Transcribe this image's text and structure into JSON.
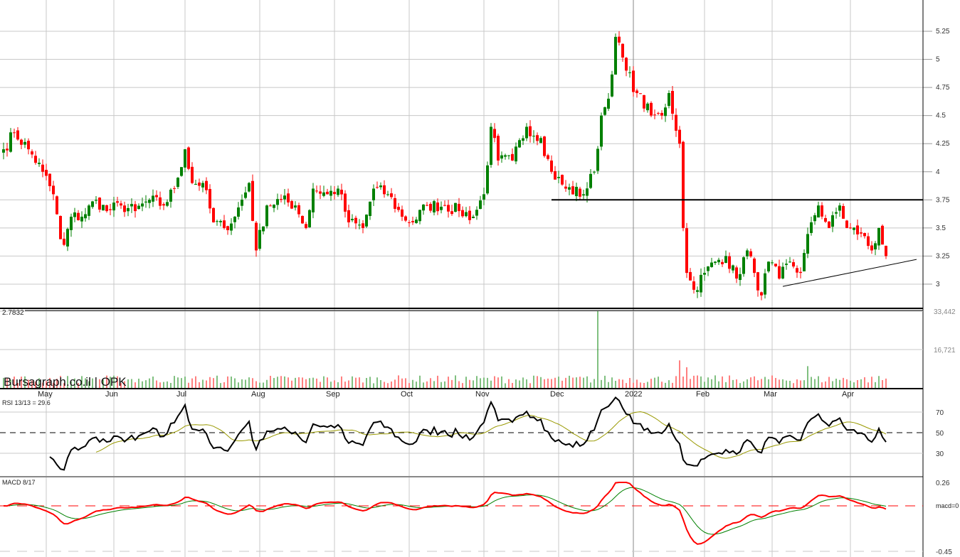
{
  "chart_data": {
    "type": "candlestick",
    "title": "Bursagraph.co.il | OPK",
    "symbol": "OPK",
    "months": [
      "May",
      "Jun",
      "Jul",
      "Aug",
      "Sep",
      "Oct",
      "Nov",
      "Dec",
      "2022",
      "Feb",
      "Mar",
      "Apr"
    ],
    "month_day_index": [
      12,
      31,
      51,
      72,
      93,
      114,
      135,
      156,
      177,
      197,
      216,
      238
    ],
    "price_ticks": [
      3,
      3.25,
      3.5,
      3.75,
      4,
      4.25,
      4.5,
      4.75,
      5,
      5.25
    ],
    "price_tick_labels": [
      "3",
      "3.25",
      "3.5",
      "3.75",
      "4",
      "4.25",
      "4.5",
      "4.75",
      "5",
      "5.25"
    ],
    "ylim": [
      2.78,
      5.3
    ],
    "min_label": "2.7832",
    "min_value": 2.7832,
    "resistance_level": 3.75,
    "resistance_from_day": 154,
    "trendline": {
      "from": [
        219,
        2.98
      ],
      "to": [
        255,
        3.22
      ]
    },
    "close_keypoints": [
      [
        0,
        4.2
      ],
      [
        3,
        4.35
      ],
      [
        7,
        4.2
      ],
      [
        11,
        4.0
      ],
      [
        14,
        3.8
      ],
      [
        16,
        3.4
      ],
      [
        17,
        3.35
      ],
      [
        19,
        3.6
      ],
      [
        22,
        3.6
      ],
      [
        26,
        3.75
      ],
      [
        29,
        3.65
      ],
      [
        33,
        3.7
      ],
      [
        37,
        3.65
      ],
      [
        41,
        3.75
      ],
      [
        45,
        3.7
      ],
      [
        48,
        3.85
      ],
      [
        51,
        4.2
      ],
      [
        53,
        3.9
      ],
      [
        56,
        3.9
      ],
      [
        59,
        3.55
      ],
      [
        62,
        3.5
      ],
      [
        65,
        3.6
      ],
      [
        69,
        3.9
      ],
      [
        71,
        3.3
      ],
      [
        74,
        3.7
      ],
      [
        78,
        3.75
      ],
      [
        82,
        3.7
      ],
      [
        85,
        3.5
      ],
      [
        87,
        3.85
      ],
      [
        91,
        3.8
      ],
      [
        94,
        3.85
      ],
      [
        97,
        3.55
      ],
      [
        101,
        3.5
      ],
      [
        104,
        3.85
      ],
      [
        108,
        3.8
      ],
      [
        112,
        3.6
      ],
      [
        115,
        3.55
      ],
      [
        119,
        3.7
      ],
      [
        124,
        3.7
      ],
      [
        128,
        3.65
      ],
      [
        132,
        3.6
      ],
      [
        135,
        3.8
      ],
      [
        137,
        4.4
      ],
      [
        139,
        4.1
      ],
      [
        143,
        4.1
      ],
      [
        147,
        4.4
      ],
      [
        151,
        4.3
      ],
      [
        154,
        4.0
      ],
      [
        158,
        3.85
      ],
      [
        163,
        3.8
      ],
      [
        166,
        4.0
      ],
      [
        168,
        4.5
      ],
      [
        170,
        4.65
      ],
      [
        172,
        5.2
      ],
      [
        175,
        4.9
      ],
      [
        178,
        4.7
      ],
      [
        182,
        4.5
      ],
      [
        185,
        4.5
      ],
      [
        187,
        4.7
      ],
      [
        190,
        4.25
      ],
      [
        191,
        3.5
      ],
      [
        192,
        3.1
      ],
      [
        194,
        2.95
      ],
      [
        197,
        3.1
      ],
      [
        200,
        3.2
      ],
      [
        203,
        3.25
      ],
      [
        206,
        3.05
      ],
      [
        209,
        3.3
      ],
      [
        211,
        3.1
      ],
      [
        213,
        2.9
      ],
      [
        215,
        3.2
      ],
      [
        218,
        3.05
      ],
      [
        221,
        3.2
      ],
      [
        224,
        3.1
      ],
      [
        227,
        3.55
      ],
      [
        229,
        3.7
      ],
      [
        232,
        3.5
      ],
      [
        235,
        3.7
      ],
      [
        237,
        3.5
      ],
      [
        241,
        3.45
      ],
      [
        244,
        3.3
      ],
      [
        246,
        3.5
      ],
      [
        248,
        3.25
      ]
    ],
    "volume_ticks": [
      16721,
      33442
    ],
    "volume_tick_labels": [
      "16,721",
      "33,442"
    ],
    "volume_spikes": [
      [
        167,
        33442
      ],
      [
        190,
        12000
      ],
      [
        192,
        9000
      ],
      [
        226,
        9500
      ],
      [
        140,
        5000
      ]
    ],
    "rsi": {
      "label": "RSI 13/13 = 29.6",
      "period": 13,
      "ticks": [
        "30",
        "50",
        "70"
      ],
      "last": 29.6
    },
    "macd": {
      "label": "MACD 8/17",
      "fast": 8,
      "slow": 17,
      "zero_label": "macd=0",
      "ticks": [
        "0.26",
        "-0.45"
      ],
      "ylim": [
        -0.45,
        0.26
      ]
    },
    "colors": {
      "up": "#008000",
      "down": "#ff0000",
      "rsi": "#000000",
      "rsi_ma": "#999900",
      "macd": "#ff0000",
      "signal": "#008000"
    }
  }
}
